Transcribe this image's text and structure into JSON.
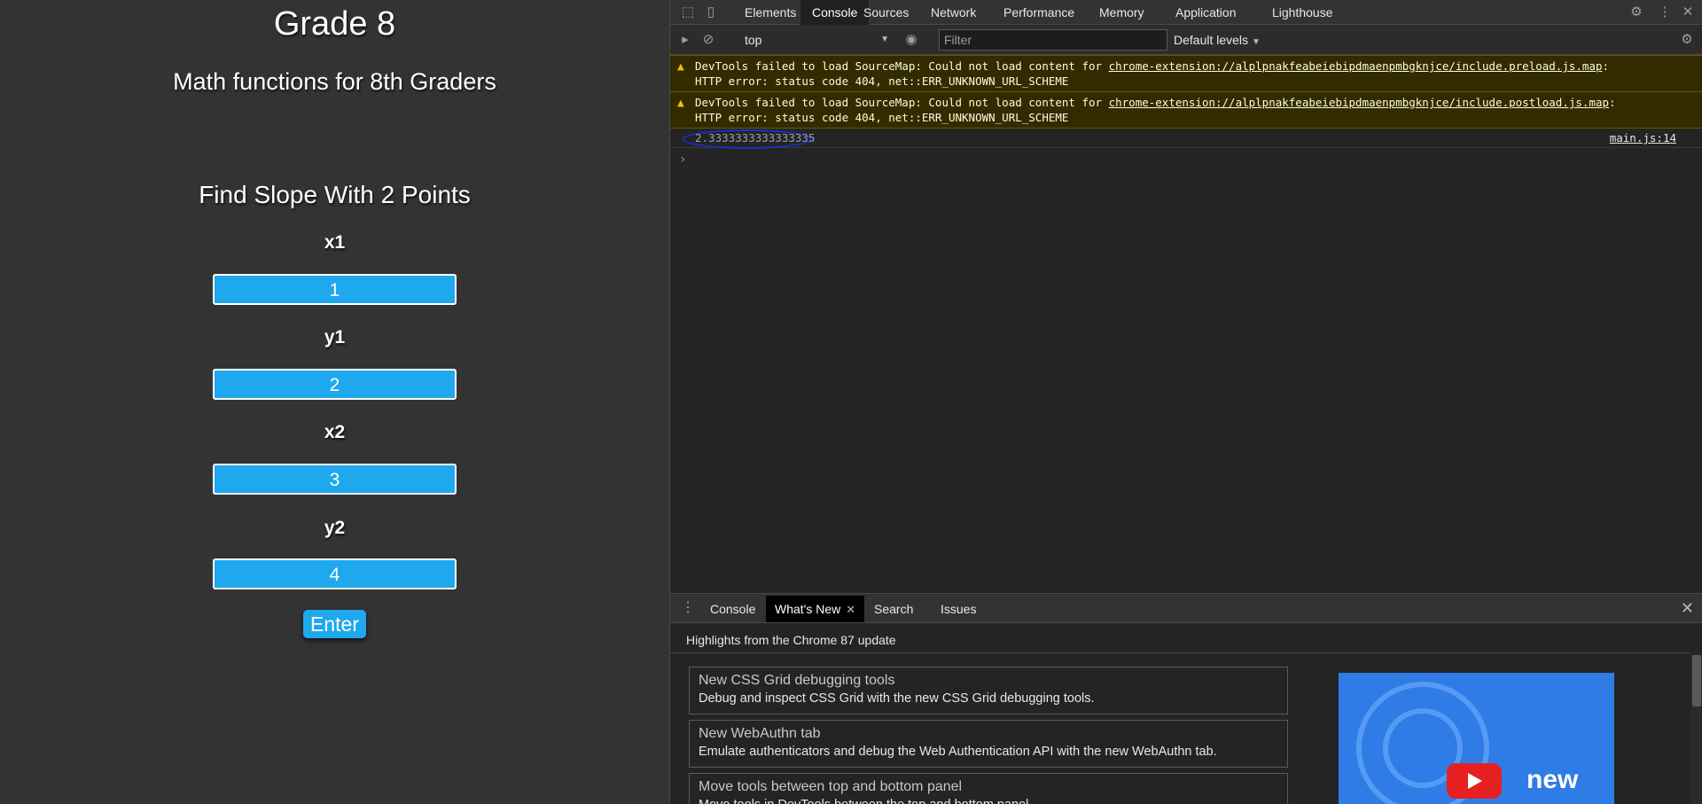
{
  "page": {
    "title": "Grade 8",
    "subtitle": "Math functions for 8th Graders",
    "section_title": "Find Slope With 2 Points",
    "fields": [
      {
        "label": "x1",
        "value": "1"
      },
      {
        "label": "y1",
        "value": "2"
      },
      {
        "label": "x2",
        "value": "3"
      },
      {
        "label": "y2",
        "value": "4"
      }
    ],
    "enter_label": "Enter"
  },
  "devtools": {
    "tabs": [
      "Elements",
      "Console",
      "Sources",
      "Network",
      "Performance",
      "Memory",
      "Application",
      "Lighthouse"
    ],
    "active_tab": "Console",
    "context": "top",
    "filter_placeholder": "Filter",
    "levels": "Default levels",
    "warnings": [
      {
        "text": "DevTools failed to load SourceMap: Could not load content for ",
        "link": "chrome-extension://alplpnakfeabeiebipdmaenpmbgknjce/include.preload.js.map",
        "tail": ":\nHTTP error: status code 404, net::ERR_UNKNOWN_URL_SCHEME"
      },
      {
        "text": "DevTools failed to load SourceMap: Could not load content for ",
        "link": "chrome-extension://alplpnakfeabeiebipdmaenpmbgknjce/include.postload.js.map",
        "tail": ":\nHTTP error: status code 404, net::ERR_UNKNOWN_URL_SCHEME"
      }
    ],
    "log": {
      "value": "2.3333333333333335",
      "source": "main.js:14"
    },
    "drawer": {
      "tabs": [
        "Console",
        "What's New",
        "Search",
        "Issues"
      ],
      "active_tab": "What's New",
      "highlights": "Highlights from the Chrome 87 update",
      "cards": [
        {
          "title": "New CSS Grid debugging tools",
          "desc": "Debug and inspect CSS Grid with the new CSS Grid debugging tools."
        },
        {
          "title": "New WebAuthn tab",
          "desc": "Emulate authenticators and debug the Web Authentication API with the new WebAuthn tab."
        },
        {
          "title": "Move tools between top and bottom panel",
          "desc": "Move tools in DevTools between the top and bottom panel."
        }
      ],
      "video_label": "new"
    }
  },
  "colors": {
    "input_bg": "#1fa8ee",
    "page_bg": "#333333",
    "annotation": "#1a2fd0",
    "warning_bg": "#332b00"
  }
}
